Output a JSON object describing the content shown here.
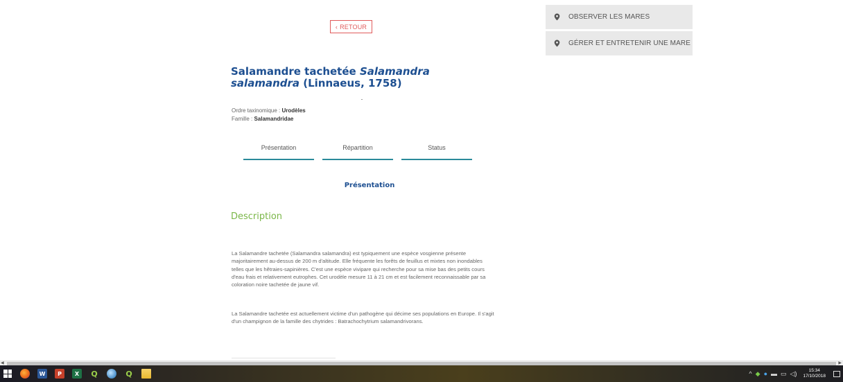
{
  "back_button": {
    "label": "RETOUR",
    "icon": "chevron-left-icon"
  },
  "side_menu": [
    {
      "label": "OBSERVER LES MARES",
      "icon": "map-pin-icon"
    },
    {
      "label": "GÉRER ET ENTRETENIR UNE MARE",
      "icon": "map-pin-icon"
    }
  ],
  "species": {
    "title_common": "Salamandre tachetée",
    "title_latin": "Salamandra salamandra",
    "title_author": "(Linnaeus, 1758)",
    "order_label": "Ordre taxinomique :",
    "order_value": "Urodèles",
    "family_label": "Famille :",
    "family_value": "Salamandridae"
  },
  "tabs": [
    "Présentation",
    "Répartition",
    "Status"
  ],
  "section_title": "Présentation",
  "description_title": "Description",
  "paragraphs": [
    "La Salamandre tachetée (Salamandra salamandra) est typiquement une espèce vosgienne présente majoritairement au-dessus de 200 m d'altitude. Elle fréquente les forêts de feuillus et mixtes non inondables telles que les hêtraies-sapinières. C'est une espèce vivipare qui recherche pour sa mise bas des petits cours d'eau frais et relativement eutrophes. Cet urodèle mesure 11 à 21 cm et est facilement reconnaissable par sa coloration noire tachetée de jaune vif.",
    "La Salamandre tachetée est actuellement victime d'un pathogène qui décime ses populations en Europe. Il s'agit d'un champignon de la famille des chytrides : Batrachochytrium salamandrivorans."
  ],
  "taskbar": {
    "apps": [
      {
        "name": "windows-start-icon",
        "color": "#ffffff"
      },
      {
        "name": "firefox-icon",
        "color": "#e8641a"
      },
      {
        "name": "word-icon",
        "letter": "W",
        "color": "#2b5797"
      },
      {
        "name": "powerpoint-icon",
        "letter": "P",
        "color": "#c5402a"
      },
      {
        "name": "excel-icon",
        "letter": "X",
        "color": "#1e7145"
      },
      {
        "name": "qgis-icon",
        "letter": "Q",
        "color": "#7aa33a"
      },
      {
        "name": "qgis-globe-icon",
        "color": "#4a8fc9"
      },
      {
        "name": "qgis-alt-icon",
        "letter": "Q",
        "color": "#7aa33a"
      },
      {
        "name": "file-explorer-icon",
        "color": "#e8b730"
      }
    ],
    "clock_time": "15:34",
    "clock_date": "17/10/2018"
  }
}
